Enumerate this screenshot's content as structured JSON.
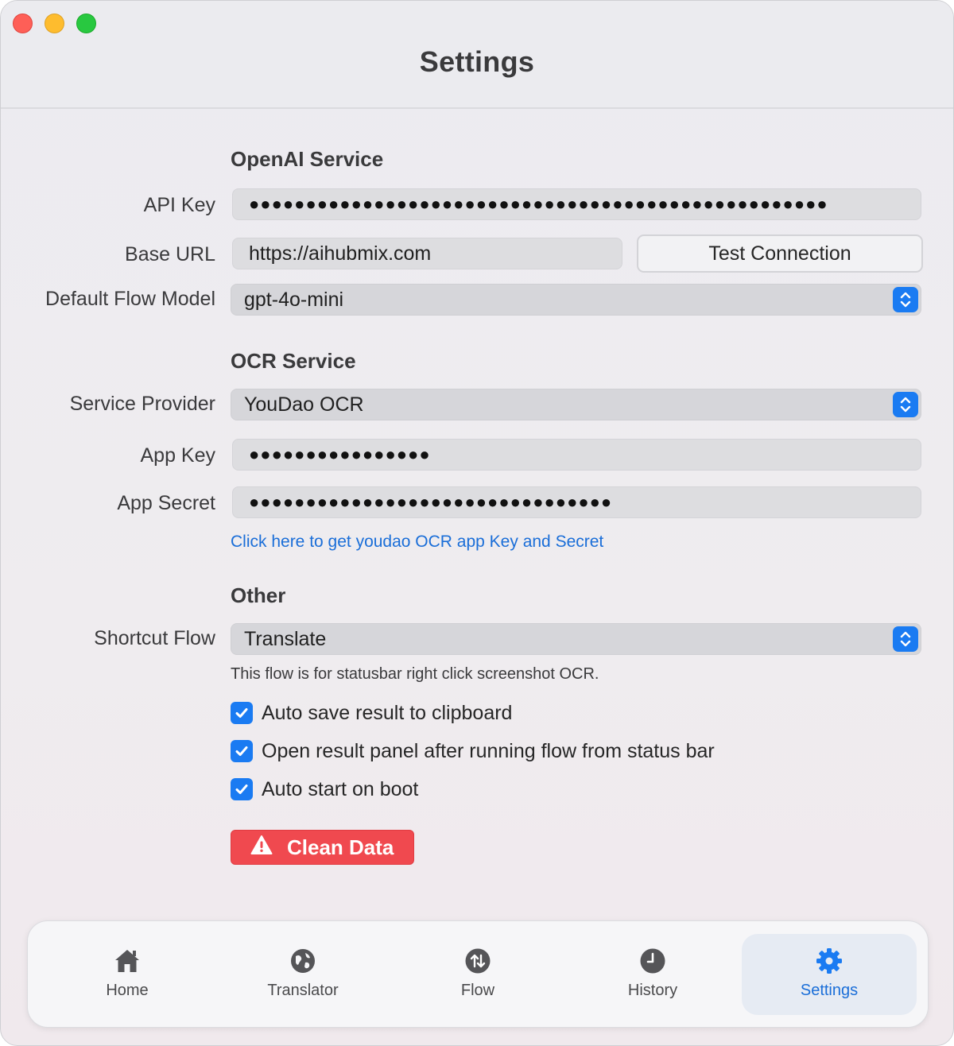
{
  "window": {
    "title": "Settings"
  },
  "openai": {
    "header": "OpenAI Service",
    "api_key_label": "API Key",
    "api_key_value": "●●●●●●●●●●●●●●●●●●●●●●●●●●●●●●●●●●●●●●●●●●●●●●●●●●●",
    "base_url_label": "Base URL",
    "base_url_value": "https://aihubmix.com",
    "test_button": "Test Connection",
    "model_label": "Default Flow Model",
    "model_value": "gpt-4o-mini"
  },
  "ocr": {
    "header": "OCR Service",
    "provider_label": "Service Provider",
    "provider_value": "YouDao OCR",
    "app_key_label": "App Key",
    "app_key_value": "●●●●●●●●●●●●●●●●",
    "app_secret_label": "App Secret",
    "app_secret_value": "●●●●●●●●●●●●●●●●●●●●●●●●●●●●●●●●",
    "link": "Click here to get youdao OCR app Key and Secret"
  },
  "other": {
    "header": "Other",
    "shortcut_label": "Shortcut Flow",
    "shortcut_value": "Translate",
    "hint": "This flow is for statusbar right click screenshot OCR.",
    "checkboxes": [
      {
        "label": "Auto save result to clipboard",
        "checked": true
      },
      {
        "label": "Open result panel after running flow from status bar",
        "checked": true
      },
      {
        "label": "Auto start on boot",
        "checked": true
      }
    ],
    "clean_button": "Clean Data"
  },
  "tabs": [
    {
      "label": "Home",
      "icon": "home-icon"
    },
    {
      "label": "Translator",
      "icon": "globe-icon"
    },
    {
      "label": "Flow",
      "icon": "arrows-up-down-icon"
    },
    {
      "label": "History",
      "icon": "clock-icon"
    },
    {
      "label": "Settings",
      "icon": "gear-icon",
      "active": true
    }
  ],
  "colors": {
    "accent": "#1a7bf2",
    "link": "#1a6ed8",
    "danger": "#f0494f"
  }
}
